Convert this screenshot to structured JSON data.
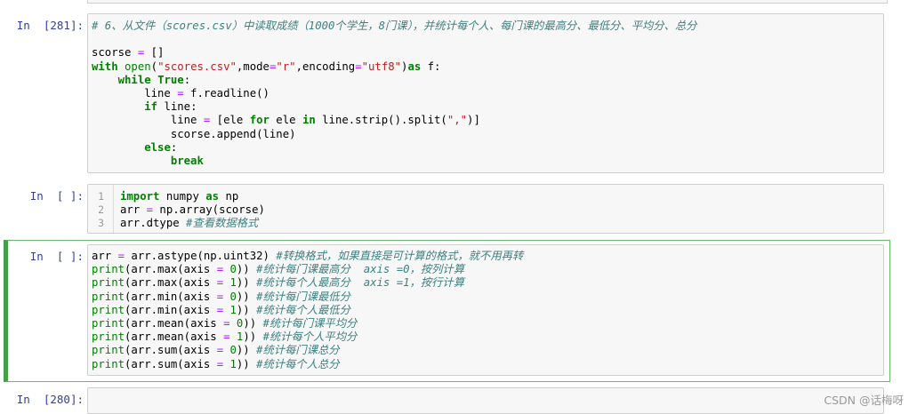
{
  "cells": [
    {
      "prompt": "In  [281]:",
      "lines": [
        [
          {
            "t": "# 6、从文件（scores.csv）中读取成绩（1000个学生，8门课），并统计每个人、每门课的最高分、最低分、平均分、总分",
            "c": "com"
          }
        ],
        [
          {
            "t": "",
            "c": ""
          }
        ],
        [
          {
            "t": "scorse ",
            "c": ""
          },
          {
            "t": "=",
            "c": "op"
          },
          {
            "t": " []",
            "c": ""
          }
        ],
        [
          {
            "t": "with",
            "c": "kw"
          },
          {
            "t": " ",
            "c": ""
          },
          {
            "t": "open",
            "c": "bi"
          },
          {
            "t": "(",
            "c": ""
          },
          {
            "t": "\"scores.csv\"",
            "c": "str"
          },
          {
            "t": ",mode",
            "c": ""
          },
          {
            "t": "=",
            "c": "op"
          },
          {
            "t": "\"r\"",
            "c": "str"
          },
          {
            "t": ",encoding",
            "c": ""
          },
          {
            "t": "=",
            "c": "op"
          },
          {
            "t": "\"utf8\"",
            "c": "str"
          },
          {
            "t": ")",
            "c": ""
          },
          {
            "t": "as",
            "c": "kw"
          },
          {
            "t": " f:",
            "c": ""
          }
        ],
        [
          {
            "t": "    ",
            "c": ""
          },
          {
            "t": "while",
            "c": "kw"
          },
          {
            "t": " ",
            "c": ""
          },
          {
            "t": "True",
            "c": "kw"
          },
          {
            "t": ":",
            "c": ""
          }
        ],
        [
          {
            "t": "        line ",
            "c": ""
          },
          {
            "t": "=",
            "c": "op"
          },
          {
            "t": " f.readline()",
            "c": ""
          }
        ],
        [
          {
            "t": "        ",
            "c": ""
          },
          {
            "t": "if",
            "c": "kw"
          },
          {
            "t": " line:",
            "c": ""
          }
        ],
        [
          {
            "t": "            line ",
            "c": ""
          },
          {
            "t": "=",
            "c": "op"
          },
          {
            "t": " [ele ",
            "c": ""
          },
          {
            "t": "for",
            "c": "kw"
          },
          {
            "t": " ele ",
            "c": ""
          },
          {
            "t": "in",
            "c": "kw"
          },
          {
            "t": " line.strip().split(",
            "c": ""
          },
          {
            "t": "\",\"",
            "c": "str"
          },
          {
            "t": ")]",
            "c": ""
          }
        ],
        [
          {
            "t": "            scorse.append(line)",
            "c": ""
          }
        ],
        [
          {
            "t": "        ",
            "c": ""
          },
          {
            "t": "else",
            "c": "kw"
          },
          {
            "t": ":",
            "c": ""
          }
        ],
        [
          {
            "t": "            ",
            "c": ""
          },
          {
            "t": "break",
            "c": "kw"
          }
        ]
      ]
    },
    {
      "prompt": "In  [ ]:",
      "gutter": [
        "1",
        "2",
        "3"
      ],
      "lines": [
        [
          {
            "t": "import",
            "c": "kw"
          },
          {
            "t": " numpy ",
            "c": ""
          },
          {
            "t": "as",
            "c": "kw"
          },
          {
            "t": " np",
            "c": ""
          }
        ],
        [
          {
            "t": "arr ",
            "c": ""
          },
          {
            "t": "=",
            "c": "op"
          },
          {
            "t": " np.array(scorse)",
            "c": ""
          }
        ],
        [
          {
            "t": "arr.dtype ",
            "c": ""
          },
          {
            "t": "#查看数据格式",
            "c": "com"
          }
        ]
      ]
    },
    {
      "prompt": "In  [ ]:",
      "lines": [
        [
          {
            "t": "arr ",
            "c": ""
          },
          {
            "t": "=",
            "c": "op"
          },
          {
            "t": " arr.astype(np.uint32) ",
            "c": ""
          },
          {
            "t": "#转换格式，如果直接是可计算的格式，就不用再转",
            "c": "com"
          }
        ],
        [
          {
            "t": "print",
            "c": "bi"
          },
          {
            "t": "(arr.max(axis ",
            "c": ""
          },
          {
            "t": "=",
            "c": "op"
          },
          {
            "t": " ",
            "c": ""
          },
          {
            "t": "0",
            "c": "num"
          },
          {
            "t": ")) ",
            "c": ""
          },
          {
            "t": "#统计每门课最高分  axis =0，按列计算",
            "c": "com"
          }
        ],
        [
          {
            "t": "print",
            "c": "bi"
          },
          {
            "t": "(arr.max(axis ",
            "c": ""
          },
          {
            "t": "=",
            "c": "op"
          },
          {
            "t": " ",
            "c": ""
          },
          {
            "t": "1",
            "c": "num"
          },
          {
            "t": ")) ",
            "c": ""
          },
          {
            "t": "#统计每个人最高分  axis =1，按行计算",
            "c": "com"
          }
        ],
        [
          {
            "t": "print",
            "c": "bi"
          },
          {
            "t": "(arr.min(axis ",
            "c": ""
          },
          {
            "t": "=",
            "c": "op"
          },
          {
            "t": " ",
            "c": ""
          },
          {
            "t": "0",
            "c": "num"
          },
          {
            "t": ")) ",
            "c": ""
          },
          {
            "t": "#统计每门课最低分",
            "c": "com"
          }
        ],
        [
          {
            "t": "print",
            "c": "bi"
          },
          {
            "t": "(arr.min(axis ",
            "c": ""
          },
          {
            "t": "=",
            "c": "op"
          },
          {
            "t": " ",
            "c": ""
          },
          {
            "t": "1",
            "c": "num"
          },
          {
            "t": ")) ",
            "c": ""
          },
          {
            "t": "#统计每个人最低分",
            "c": "com"
          }
        ],
        [
          {
            "t": "print",
            "c": "bi"
          },
          {
            "t": "(arr.mean(axis ",
            "c": ""
          },
          {
            "t": "=",
            "c": "op"
          },
          {
            "t": " ",
            "c": ""
          },
          {
            "t": "0",
            "c": "num"
          },
          {
            "t": ")) ",
            "c": ""
          },
          {
            "t": "#统计每门课平均分",
            "c": "com"
          }
        ],
        [
          {
            "t": "print",
            "c": "bi"
          },
          {
            "t": "(arr.mean(axis ",
            "c": ""
          },
          {
            "t": "=",
            "c": "op"
          },
          {
            "t": " ",
            "c": ""
          },
          {
            "t": "1",
            "c": "num"
          },
          {
            "t": ")) ",
            "c": ""
          },
          {
            "t": "#统计每个人平均分",
            "c": "com"
          }
        ],
        [
          {
            "t": "print",
            "c": "bi"
          },
          {
            "t": "(arr.sum(axis ",
            "c": ""
          },
          {
            "t": "=",
            "c": "op"
          },
          {
            "t": " ",
            "c": ""
          },
          {
            "t": "0",
            "c": "num"
          },
          {
            "t": ")) ",
            "c": ""
          },
          {
            "t": "#统计每门课总分",
            "c": "com"
          }
        ],
        [
          {
            "t": "print",
            "c": "bi"
          },
          {
            "t": "(arr.sum(axis ",
            "c": ""
          },
          {
            "t": "=",
            "c": "op"
          },
          {
            "t": " ",
            "c": ""
          },
          {
            "t": "1",
            "c": "num"
          },
          {
            "t": ")) ",
            "c": ""
          },
          {
            "t": "#统计每个人总分",
            "c": "com"
          }
        ]
      ]
    },
    {
      "prompt": "In  [280]:",
      "lines": []
    }
  ],
  "watermark": "CSDN @话梅呀",
  "colors": {
    "prompt": "#303f9f",
    "keyword": "#008000",
    "string": "#ba2121",
    "comment": "#408080",
    "operator": "#aa22ff",
    "selected": "#42a047"
  }
}
